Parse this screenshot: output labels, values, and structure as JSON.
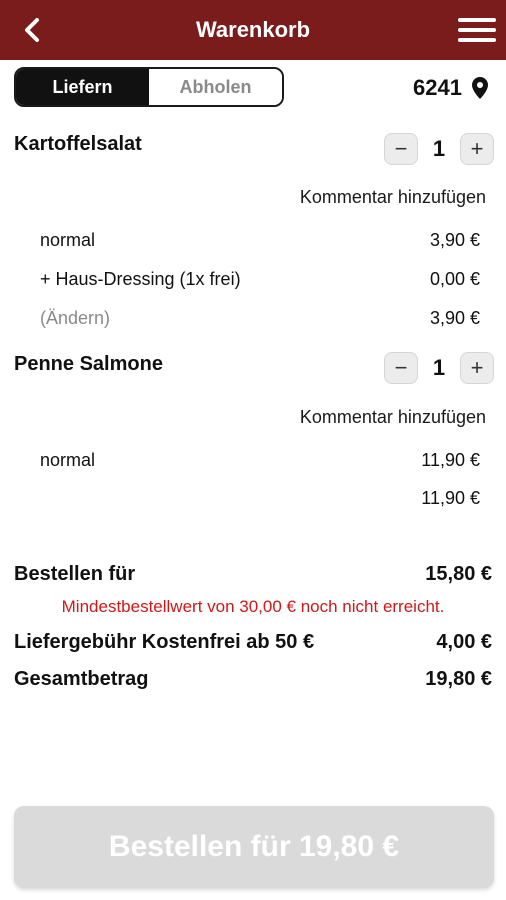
{
  "header": {
    "title": "Warenkorb",
    "back_icon": "chevron-left-icon",
    "menu_icon": "hamburger-menu-icon",
    "color": "#7a1c1c"
  },
  "mode": {
    "deliver_label": "Liefern",
    "pickup_label": "Abholen",
    "selected": "Liefern"
  },
  "location": {
    "zip": "6241",
    "icon": "map-pin-icon"
  },
  "items": [
    {
      "name": "Kartoffelsalat",
      "quantity": "1",
      "comment_label": "Kommentar hinzufügen",
      "lines": [
        {
          "label": "normal",
          "price": "3,90 €"
        },
        {
          "label": "+ Haus-Dressing (1x frei)",
          "price": "0,00 €"
        },
        {
          "label": "(Ändern)",
          "price": "3,90 €"
        }
      ]
    },
    {
      "name": "Penne Salmone",
      "quantity": "1",
      "comment_label": "Kommentar hinzufügen",
      "lines": [
        {
          "label": "normal",
          "price": "11,90 €"
        },
        {
          "label": "",
          "price": "11,90 €"
        }
      ]
    }
  ],
  "summary": {
    "order_label": "Bestellen für",
    "order_value": "15,80 €",
    "warning": "Mindestbestellwert von 30,00 € noch nicht erreicht.",
    "delivery_label": "Liefergebühr Kostenfrei ab 50 €",
    "delivery_value": "4,00 €",
    "total_label": "Gesamtbetrag",
    "total_value": "19,80 €"
  },
  "order_button": {
    "label": "Bestellen für 19,80 €",
    "enabled": false
  },
  "colors": {
    "accent": "#7a1c1c",
    "warning": "#d01818",
    "disabled_button": "#dadada"
  }
}
